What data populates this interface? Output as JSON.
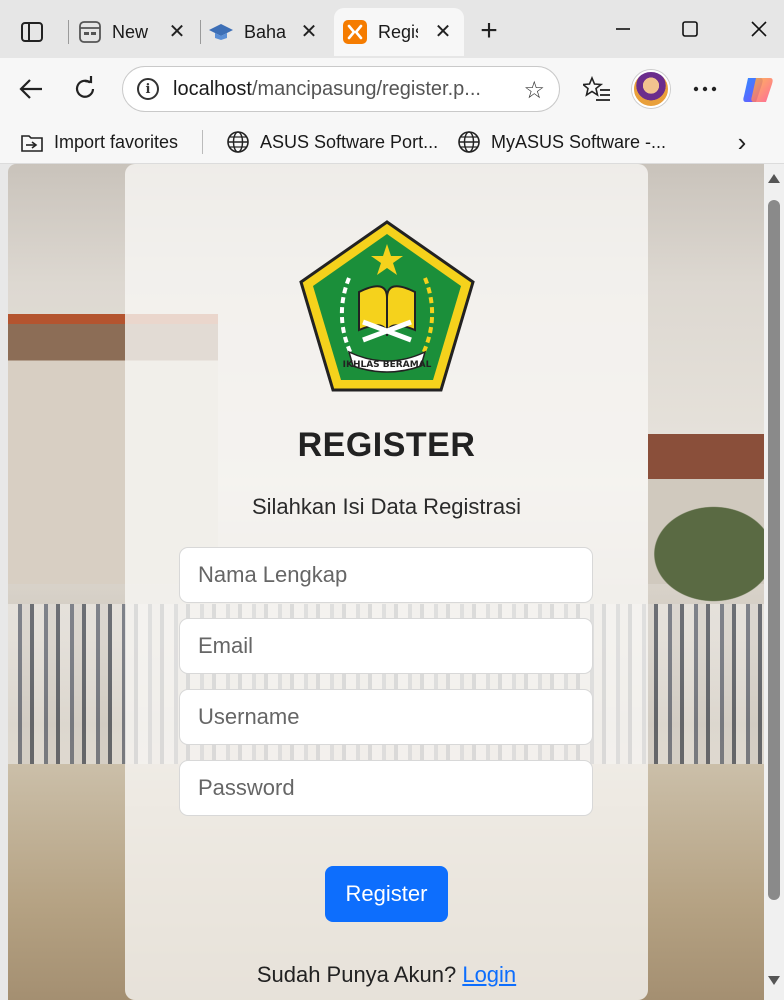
{
  "browser": {
    "tabs": [
      {
        "label": "New",
        "icon": "new-tab-page-icon"
      },
      {
        "label": "Baha",
        "icon": "graduation-cap-icon"
      },
      {
        "label": "Regis",
        "icon": "xampp-icon",
        "active": true
      }
    ],
    "address": {
      "host": "localhost",
      "path": "/mancipasung/register.p..."
    },
    "favorites": [
      {
        "label": "Import favorites",
        "icon": "import-favorites-icon"
      },
      {
        "label": "ASUS Software Port...",
        "icon": "globe-icon"
      },
      {
        "label": "MyASUS Software -...",
        "icon": "globe-icon"
      }
    ]
  },
  "page": {
    "logo_text": "IKHLAS BERAMAL",
    "title": "REGISTER",
    "subtitle": "Silahkan Isi Data Registrasi",
    "fields": {
      "name_placeholder": "Nama Lengkap",
      "email_placeholder": "Email",
      "username_placeholder": "Username",
      "password_placeholder": "Password"
    },
    "submit_label": "Register",
    "login_prompt": "Sudah Punya Akun?",
    "login_link": "Login"
  },
  "colors": {
    "primary": "#0d6efd",
    "logo_green": "#1b8f3a",
    "logo_yellow": "#f5d21c"
  }
}
